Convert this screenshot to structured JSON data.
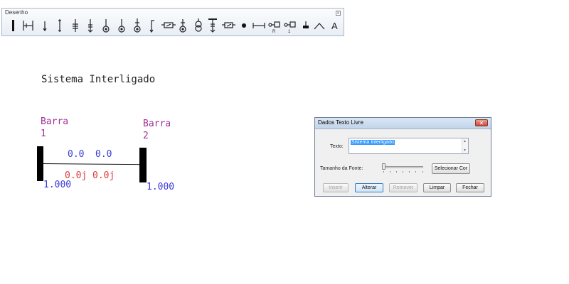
{
  "toolbar": {
    "title": "Desenho",
    "text_tool_label": "A",
    "icons": [
      "bus-bar-icon",
      "bus-section-icon",
      "load-icon",
      "line-icon",
      "transformer-icon",
      "capacitor-icon",
      "generator-icon",
      "motor-icon",
      "source-icon",
      "shunt-icon",
      "switch-icon",
      "relay-icon",
      "three-winding-icon",
      "reactor-icon",
      "breaker-icon",
      "node-icon",
      "branch-icon",
      "measurement-icon",
      "meter-icon",
      "ground-icon",
      "arc-icon",
      "text-tool-icon"
    ],
    "icon_sublabels": {
      "measurement": "R",
      "meter": "1"
    }
  },
  "diagram": {
    "title": "Sistema Interligado",
    "bus1": {
      "label_line1": "Barra",
      "label_line2": "1",
      "voltage": "1.000"
    },
    "bus2": {
      "label_line1": "Barra",
      "label_line2": "2",
      "voltage": "1.000"
    },
    "flow_p": "0.0",
    "flow_q": "0.0",
    "flow_p_j": "0.0j",
    "flow_q_j": "0.0j",
    "colors": {
      "bus_label": "#a0309a",
      "flow": "#3a3ad8",
      "reactive": "#e03a3a",
      "bar": "#000000"
    }
  },
  "dialog": {
    "title": "Dados Texto Livre",
    "close_label": "✕",
    "text_label": "Texto:",
    "text_value": "Sistema Interligado",
    "font_size_label": "Tamanho da Fonte:",
    "font_size_level": 0,
    "select_color_button": "Selecionar Cor",
    "buttons": {
      "insert": "Inserir",
      "change": "Alterar",
      "remove": "Remover",
      "clear": "Limpar",
      "close": "Fechar"
    }
  }
}
